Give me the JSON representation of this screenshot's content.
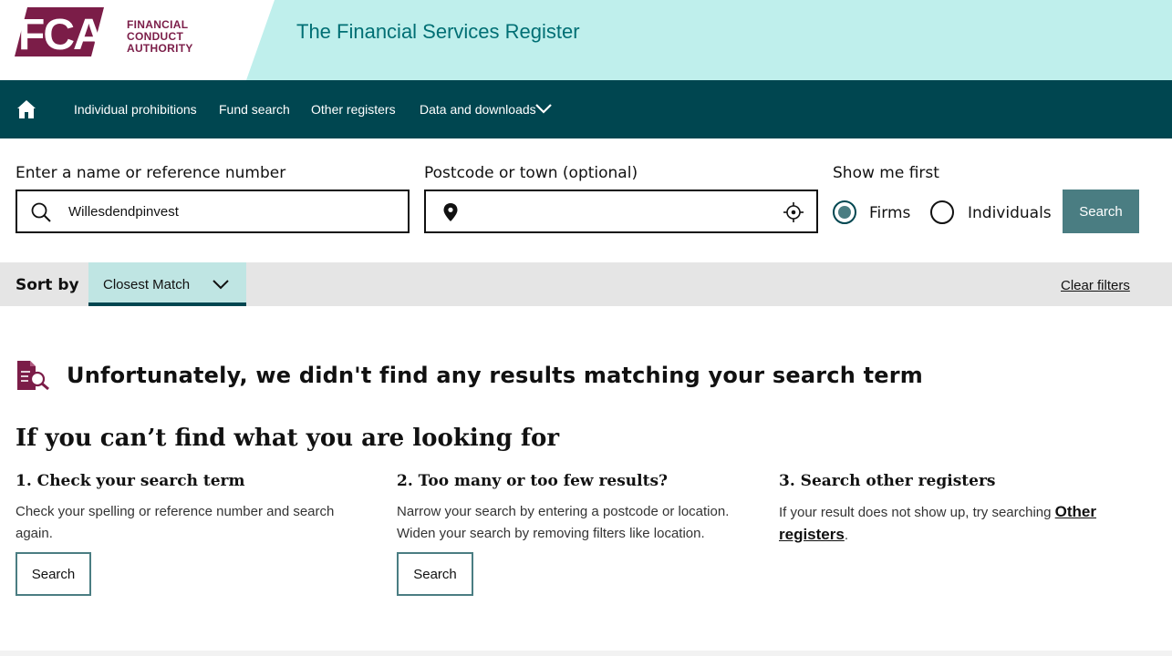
{
  "header": {
    "logo_letters": "FCA",
    "logo_lines": [
      "FINANCIAL",
      "CONDUCT",
      "AUTHORITY"
    ],
    "site_title": "The Financial Services Register",
    "brand_color": "#7b1d48",
    "band_color": "#bfefec"
  },
  "nav": {
    "home_icon": "home-icon",
    "items": [
      {
        "label": "Individual prohibitions"
      },
      {
        "label": "Fund search"
      },
      {
        "label": "Other registers"
      },
      {
        "label": "Data and downloads"
      }
    ],
    "bg_color": "#004650"
  },
  "search": {
    "name_label": "Enter a name or reference number",
    "name_value": "Willesdendpinvest",
    "location_label": "Postcode or town (optional)",
    "location_value": "",
    "show_me_first_label": "Show me first",
    "radio_options": [
      {
        "label": "Firms",
        "checked": true
      },
      {
        "label": "Individuals",
        "checked": false
      }
    ],
    "search_button": "Search"
  },
  "sort": {
    "label": "Sort by",
    "selected": "Closest Match",
    "clear_filters": "Clear filters"
  },
  "results": {
    "no_results_message": "Unfortunately, we didn't find any results matching your search term"
  },
  "help": {
    "title": "If you can’t find what you are looking for",
    "columns": [
      {
        "heading": "1. Check your search term",
        "text": "Check your spelling or reference number and search again.",
        "button": "Search"
      },
      {
        "heading": "2. Too many or too few results?",
        "text": "Narrow your search by entering a postcode or location. Widen your search by removing filters like location.",
        "button": "Search"
      },
      {
        "heading": "3. Search other registers",
        "text_before_link": "If your result does not show up, try searching ",
        "link": "Other registers",
        "text_after_link": "."
      }
    ]
  }
}
